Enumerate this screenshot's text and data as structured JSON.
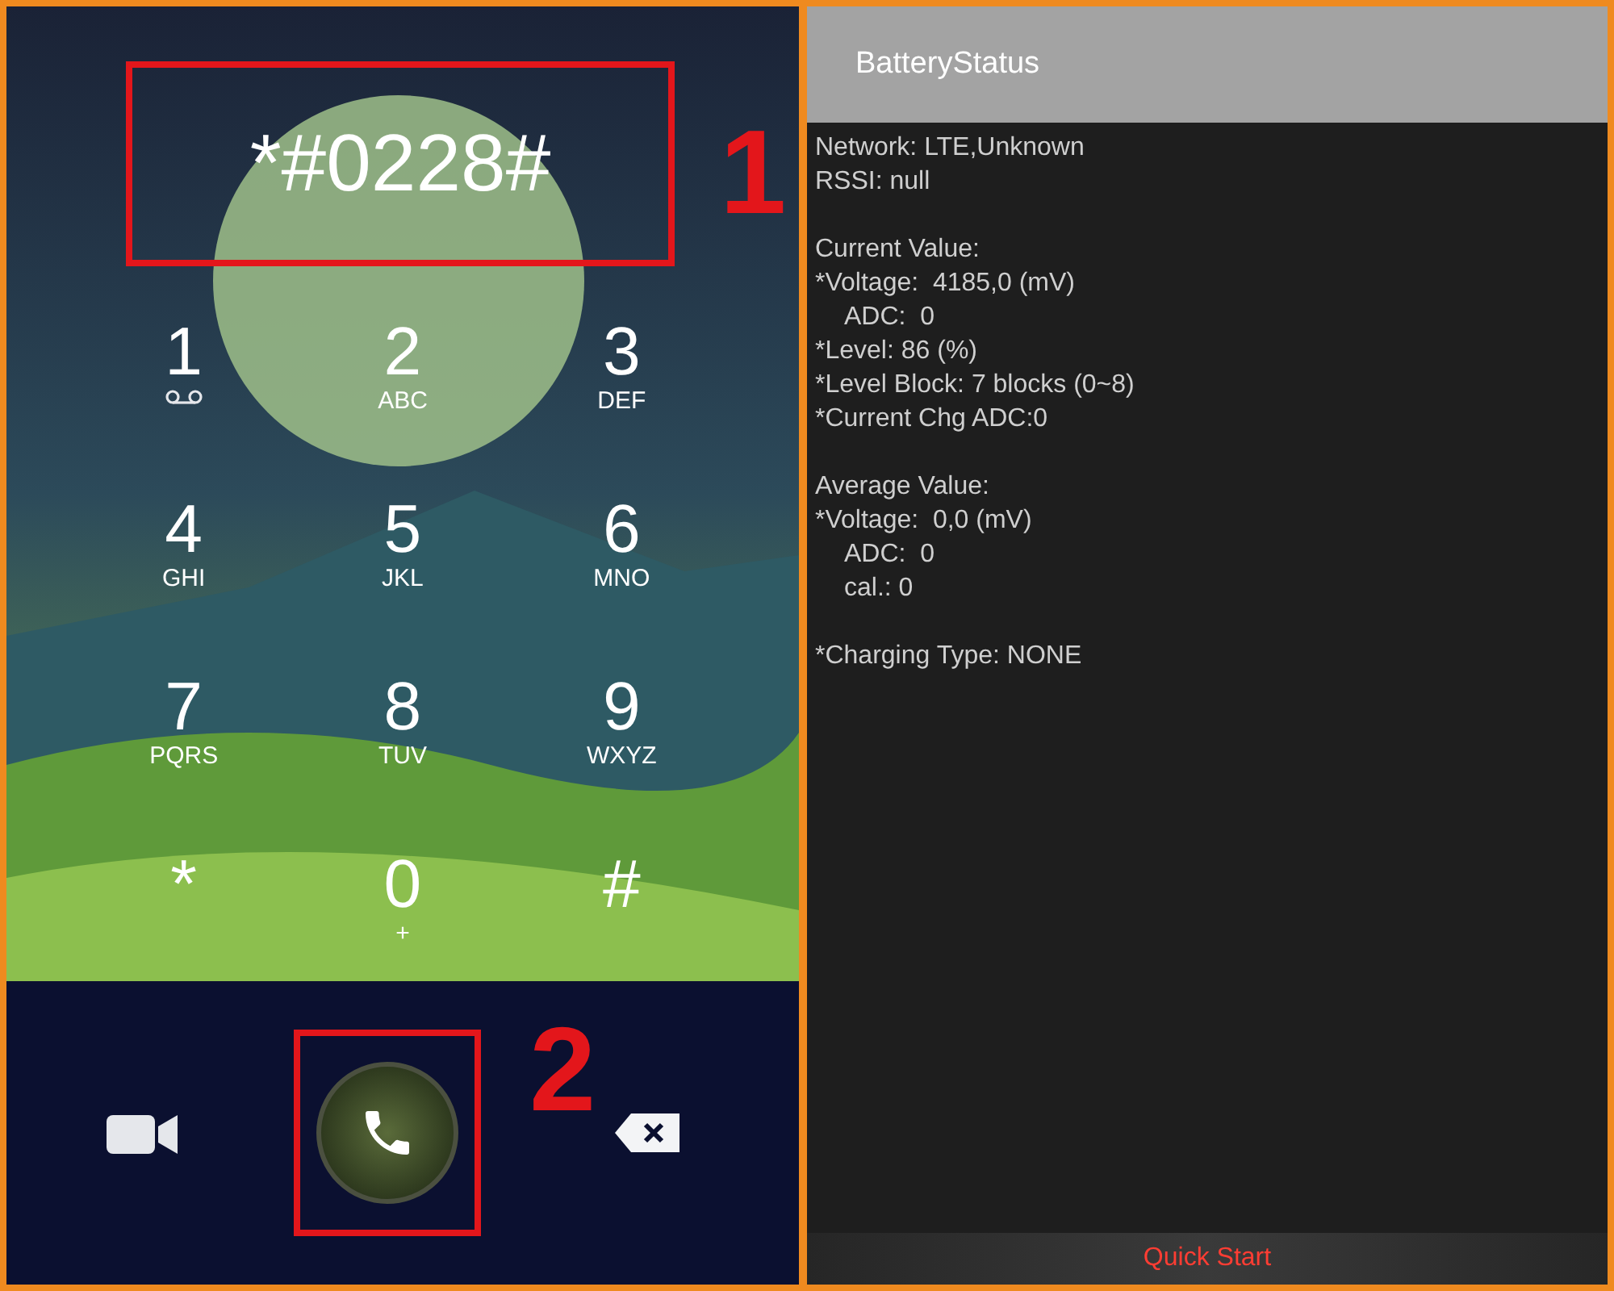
{
  "dialer": {
    "number": "*#0228#",
    "keys": [
      {
        "digit": "1",
        "kind": "voicemail"
      },
      {
        "digit": "2",
        "kind": "letters",
        "letters": "ABC"
      },
      {
        "digit": "3",
        "kind": "letters",
        "letters": "DEF"
      },
      {
        "digit": "4",
        "kind": "letters",
        "letters": "GHI"
      },
      {
        "digit": "5",
        "kind": "letters",
        "letters": "JKL"
      },
      {
        "digit": "6",
        "kind": "letters",
        "letters": "MNO"
      },
      {
        "digit": "7",
        "kind": "letters",
        "letters": "PQRS"
      },
      {
        "digit": "8",
        "kind": "letters",
        "letters": "TUV"
      },
      {
        "digit": "9",
        "kind": "letters",
        "letters": "WXYZ"
      },
      {
        "digit": "*",
        "kind": "none"
      },
      {
        "digit": "0",
        "kind": "letters",
        "letters": "+"
      },
      {
        "digit": "#",
        "kind": "none"
      }
    ]
  },
  "annotations": [
    {
      "label": "1"
    },
    {
      "label": "2"
    }
  ],
  "battery_app": {
    "title": "BatteryStatus",
    "sections": [
      {
        "lines": [
          {
            "text": "Network: LTE,Unknown",
            "indented": false
          },
          {
            "text": "RSSI: null",
            "indented": false
          }
        ]
      },
      {
        "lines": [
          {
            "text": "Current Value:",
            "indented": false
          },
          {
            "text": "*Voltage:  4185,0 (mV)",
            "indented": false
          },
          {
            "text": "ADC:  0",
            "indented": true
          },
          {
            "text": "*Level: 86 (%)",
            "indented": false
          },
          {
            "text": "*Level Block: 7 blocks (0~8)",
            "indented": false
          },
          {
            "text": "*Current Chg ADC:0",
            "indented": false
          }
        ]
      },
      {
        "lines": [
          {
            "text": "Average Value:",
            "indented": false
          },
          {
            "text": "*Voltage:  0,0 (mV)",
            "indented": false
          },
          {
            "text": "ADC:  0",
            "indented": true
          },
          {
            "text": "cal.: 0",
            "indented": true
          }
        ]
      },
      {
        "lines": [
          {
            "text": "*Charging Type: NONE",
            "indented": false
          }
        ]
      }
    ],
    "footer_button": "Quick Start"
  }
}
